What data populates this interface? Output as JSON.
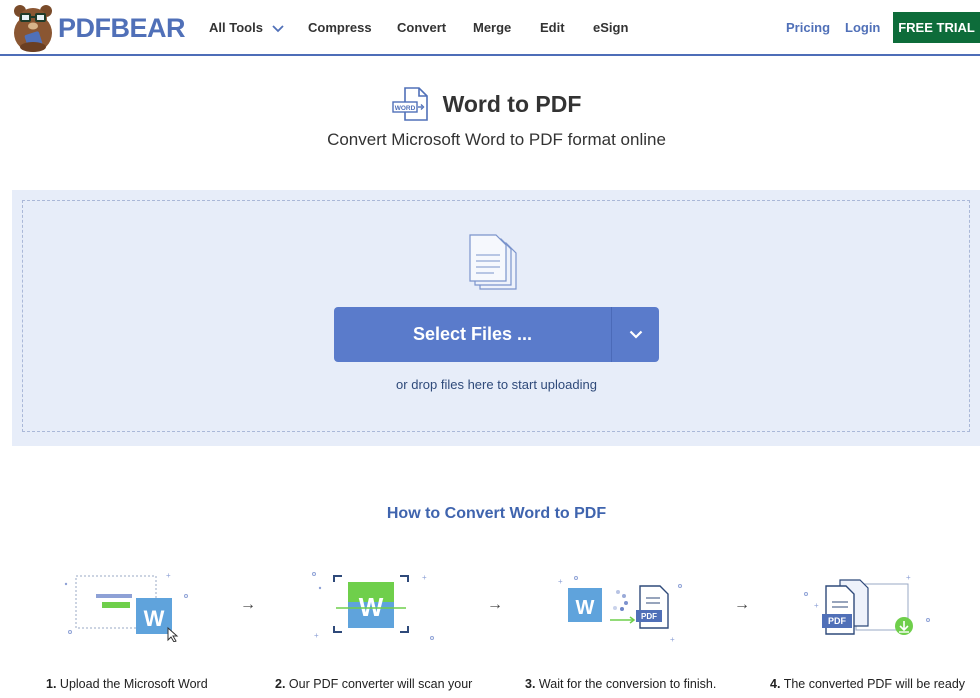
{
  "brand": {
    "name": "PDFBEAR"
  },
  "nav": {
    "all_tools": "All Tools",
    "compress": "Compress",
    "convert": "Convert",
    "merge": "Merge",
    "edit": "Edit",
    "esign": "eSign",
    "pricing": "Pricing",
    "login": "Login",
    "free_trial": "FREE TRIAL"
  },
  "page": {
    "icon_label": "WORD",
    "title": "Word to PDF",
    "subtitle": "Convert Microsoft Word to PDF format online"
  },
  "upload": {
    "button_label": "Select Files ...",
    "hint": "or drop files here to start uploading"
  },
  "how_to": {
    "title": "How to Convert Word to PDF",
    "steps": [
      {
        "num": "1.",
        "text": "Upload the Microsoft Word"
      },
      {
        "num": "2.",
        "text": "Our PDF converter will scan your"
      },
      {
        "num": "3.",
        "text": "Wait for the conversion to finish."
      },
      {
        "num": "4.",
        "text": "The converted PDF will be ready"
      }
    ],
    "icon_letter": "W",
    "pdf_label": "PDF",
    "arrow": "→"
  },
  "colors": {
    "brand_blue": "#5070b8",
    "trial_green": "#0d6c3a",
    "button_blue": "#5a7bcb",
    "drop_bg": "#e7edf9",
    "word_tile": "#5fa3dc",
    "green_bar": "#6fcf4b"
  }
}
